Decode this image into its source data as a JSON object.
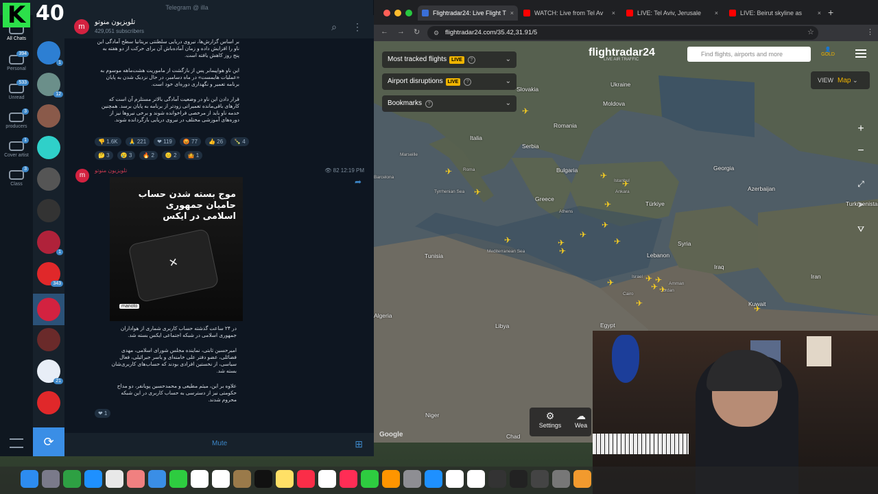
{
  "overlay_logo": {
    "letter": "K",
    "number": "40"
  },
  "telegram": {
    "window_title": "Telegram @ illa",
    "folders": [
      {
        "label": "All Chats",
        "badge": ""
      },
      {
        "label": "Personal",
        "badge": "394"
      },
      {
        "label": "Unread",
        "badge": "533"
      },
      {
        "label": "producers",
        "badge": "3"
      },
      {
        "label": "Cover artist",
        "badge": "1"
      },
      {
        "label": "Class",
        "badge": "3"
      }
    ],
    "chat_badges": [
      "1",
      "12",
      "",
      "",
      "",
      "",
      "",
      "1",
      "343",
      "",
      "",
      "21",
      ""
    ],
    "channel": {
      "name": "تلویزیون منوتو",
      "subscribers": "429,051 subscribers",
      "avatar_letter": "m"
    },
    "msg1_paragraphs": [
      "بر اساس گزارش‌ها، نیروی دریایی سلطنتی بریتانیا سطح آمادگی این ناو را افزایش داده و زمان آماده‌باش آن برای حرکت از دو هفته به پنج روز کاهش یافته است.",
      "این ناو هواپیمابر پس از بازگشت از ماموریت هشت‌ماهه موسوم به «عملیات هایمست» در ماه دسامبر، در حال نزدیک شدن به پایان برنامه تعمیر و نگهداری دوره‌ای خود است.",
      "قرار دادن این ناو در وضعیت آمادگی بالاتر مستلزم آن است که کارهای باقی‌مانده تعمیراتی زودتر از برنامه به پایان برسد. همچنین خدمه ناو باید از مرخصی فراخوانده شوند و برخی نیروها نیز از دوره‌های آموزشی مختلف در نیروی دریایی بازگردانده شوند."
    ],
    "reactions_row1": [
      "👎 1.6K",
      "🙏 221",
      "❤ 119",
      "😡 77",
      "👍 26",
      "🍾 4"
    ],
    "reactions_row2": [
      "🤔 3",
      "😢 3",
      "🔥 2",
      "😑 2",
      "🤷 1"
    ],
    "post": {
      "author": "تلویزیون منوتو",
      "meta": "👁 82 12:19 PM",
      "image_caption": "موج بسته شدن حساب حامیان جمهوری اسلامی در ایکس",
      "image_brand": "manoto",
      "paragraphs": [
        "در ۲۴ ساعت گذشته حساب کاربری شماری از هواداران جمهوری اسلامی در شبکه اجتماعی ایکس بسته شد.",
        "امیرحسین ثابتی، نماینده مجلس شورای اسلامی، مهدی فضائلی، عضو دفتر علی خامنه‌ای و یاسر جبرائیلی، فعال سیاسی، از نخستین افرادی بودند که حساب‌های کاربری‌شان بسته شد.",
        "علاوه بر این، میثم مطیعی و محمدحسین پویانفر، دو مداح حکومتی نیز از دسترسی به حساب کاربری در این شبکه محروم شدند."
      ],
      "reaction": "❤ 1"
    },
    "bottom": {
      "mute_label": "Mute"
    }
  },
  "browser": {
    "tabs": [
      {
        "title": "Flightradar24: Live Flight T",
        "active": true,
        "favicon_color": "#3a6fd8"
      },
      {
        "title": "WATCH: Live from Tel Av",
        "active": false,
        "favicon_color": "#ff0000"
      },
      {
        "title": "LIVE: Tel Aviv, Jerusale",
        "active": false,
        "favicon_color": "#ff0000"
      },
      {
        "title": "LIVE: Beirut skyline as",
        "active": false,
        "favicon_color": "#ff0000"
      }
    ],
    "url": "flightradar24.com/35.42,31.91/5"
  },
  "flightradar": {
    "logo": "flightradar24",
    "logo_sub": "LIVE AIR TRAFFIC",
    "search_placeholder": "Find flights, airports and more",
    "gold_label": "GOLD",
    "panels": [
      {
        "label": "Most tracked flights",
        "live": "LIVE"
      },
      {
        "label": "Airport disruptions",
        "live": "LIVE"
      },
      {
        "label": "Bookmarks",
        "live": ""
      }
    ],
    "view_label": "VIEW",
    "view_value": "Map",
    "settings_label": "Settings",
    "weather_label": "Wea",
    "google_label": "Google",
    "countries": [
      {
        "name": "Ukraine"
      },
      {
        "name": "Slovakia"
      },
      {
        "name": "Moldova"
      },
      {
        "name": "Romania"
      },
      {
        "name": "Italia"
      },
      {
        "name": "Serbia"
      },
      {
        "name": "Bulgaria"
      },
      {
        "name": "Georgia"
      },
      {
        "name": "Azerbaijan"
      },
      {
        "name": "Türkiye"
      },
      {
        "name": "Greece"
      },
      {
        "name": "Syria"
      },
      {
        "name": "Tunisia"
      },
      {
        "name": "Lebanon"
      },
      {
        "name": "Iraq"
      },
      {
        "name": "Iran"
      },
      {
        "name": "Libya"
      },
      {
        "name": "Egypt"
      },
      {
        "name": "Kuwait"
      },
      {
        "name": "Niger"
      },
      {
        "name": "Chad"
      },
      {
        "name": "Algeria"
      },
      {
        "name": "Israel"
      },
      {
        "name": "Jordan"
      },
      {
        "name": "Turkmenistan"
      }
    ],
    "cities": [
      {
        "name": "Marseille"
      },
      {
        "name": "Roma"
      },
      {
        "name": "Barcelona"
      },
      {
        "name": "Athens"
      },
      {
        "name": "Ankara"
      },
      {
        "name": "Istanbul"
      },
      {
        "name": "Cairo"
      },
      {
        "name": "Tyrrhenian Sea"
      },
      {
        "name": "Mediterranean Sea"
      },
      {
        "name": "Amman"
      }
    ]
  },
  "dock": {
    "apps": [
      "Finder",
      "Launchpad",
      "Safari",
      "Chrome",
      "Photos",
      "Mail",
      "FaceTime",
      "Messages",
      "Freeform",
      "Notes",
      "Apple TV",
      "Music",
      "Calendar",
      "News",
      "Numbers",
      "Pages",
      "Settings",
      "App Store",
      "Notion",
      "Calendar",
      "Logic",
      "Monitor",
      "Unity",
      "Disk",
      "Other"
    ]
  }
}
